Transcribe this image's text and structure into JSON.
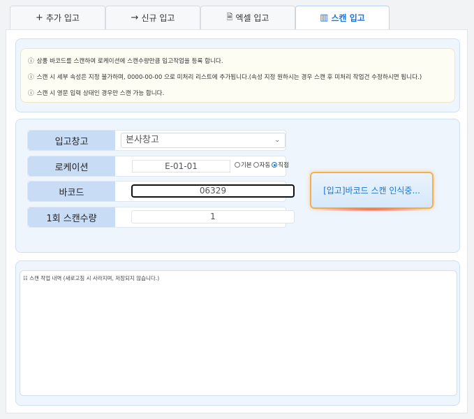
{
  "tabs": [
    {
      "icon": "+",
      "label": "추가 입고",
      "active": false
    },
    {
      "icon": "→",
      "label": "신규 입고",
      "active": false
    },
    {
      "icon": "🗎",
      "label": "엑셀 입고",
      "active": false
    },
    {
      "icon": "▥",
      "label": "스캔 입고",
      "active": true
    }
  ],
  "notices": [
    "상품 바코드를 스캔하여 로케이션에 스캔수량만큼 입고작업을 등록 합니다.",
    "스캔 시 세부 속성은 지정 불가하며, 0000-00-00 으로 미처리 리스트에 추가됩니다.(속성 지정 원하시는 경우 스캔 후 미처리 작업건 수정하시면 됩니다.)",
    "스캔 시 영문 입력 상태인 경우만 스캔 가능 합니다."
  ],
  "notice_icon": "ⓘ",
  "form": {
    "warehouse_label": "입고창고",
    "warehouse_value": "본사창고",
    "location_label": "로케이션",
    "location_value": "E-01-01",
    "location_mode_options": [
      "기본",
      "자동",
      "직접"
    ],
    "location_mode_selected": "직접",
    "barcode_label": "바코드",
    "barcode_value": "06329",
    "qty_label": "1회 스캔수량",
    "qty_value": "1"
  },
  "scan_button": {
    "label": "[입고]바코드 스캔 인식중...",
    "border_color": "#f4b04a"
  },
  "log": {
    "placeholder": "☷ 스캔 작업 내역 (새로고침 시 사라지며, 저장되지 않습니다.)"
  },
  "colors": {
    "accent": "#1e74d6",
    "label_bg": "#c9dcf6",
    "box_bg": "#eef5fd"
  }
}
